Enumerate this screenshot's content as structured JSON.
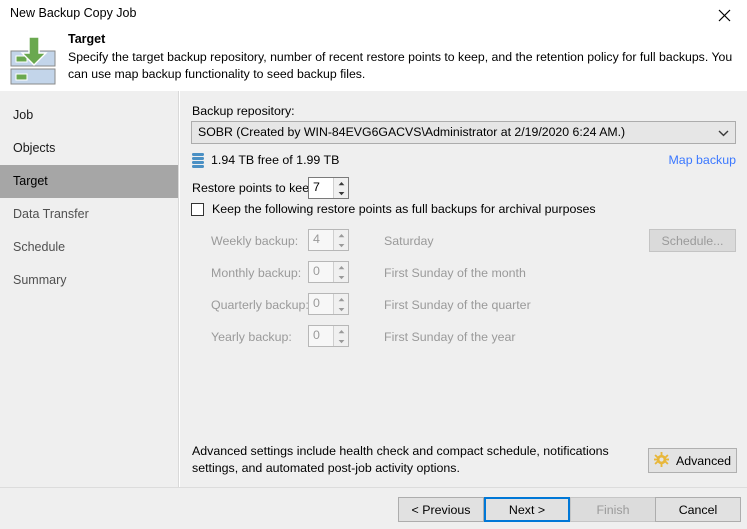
{
  "window": {
    "title": "New Backup Copy Job",
    "close_icon": "close-icon"
  },
  "header": {
    "icon": "backup-repository-download-icon",
    "title": "Target",
    "description": "Specify the target backup repository, number of recent restore points to keep, and the retention policy for full backups. You can use map backup functionality to seed backup files."
  },
  "sidebar": {
    "items": [
      {
        "label": "Job",
        "state": "done"
      },
      {
        "label": "Objects",
        "state": "done"
      },
      {
        "label": "Target",
        "state": "active"
      },
      {
        "label": "Data Transfer",
        "state": "upcoming"
      },
      {
        "label": "Schedule",
        "state": "upcoming"
      },
      {
        "label": "Summary",
        "state": "upcoming"
      }
    ]
  },
  "main": {
    "repository": {
      "label": "Backup repository:",
      "selected": "SOBR (Created by WIN-84EVG6GACVS\\Administrator at 2/19/2020 6:24 AM.)",
      "chevron_icon": "chevron-down-icon",
      "disk_icon": "repository-disk-icon",
      "free_space": "1.94 TB free of 1.99 TB",
      "map_backup_link": "Map backup"
    },
    "restore_points": {
      "label": "Restore points to keep:",
      "value": "7"
    },
    "keep_full": {
      "label": "Keep the following restore points as full backups for archival purposes",
      "checked": false
    },
    "periodic": [
      {
        "name": "Weekly backup:",
        "value": "4",
        "when": "Saturday"
      },
      {
        "name": "Monthly backup:",
        "value": "0",
        "when": "First Sunday of the month"
      },
      {
        "name": "Quarterly backup:",
        "value": "0",
        "when": "First Sunday of the quarter"
      },
      {
        "name": "Yearly backup:",
        "value": "0",
        "when": "First Sunday of the year"
      }
    ],
    "schedule_button": "Schedule...",
    "advanced": {
      "text": "Advanced settings include health check and compact schedule, notifications settings, and automated post-job activity options.",
      "button_label": "Advanced",
      "button_icon": "gear-icon"
    }
  },
  "footer": {
    "previous": "< Previous",
    "next": "Next >",
    "finish": "Finish",
    "cancel": "Cancel"
  },
  "colors": {
    "accent": "#0078d7",
    "link": "#3b78ff",
    "gear": "#e8b73a",
    "arrow_green": "#6aa84f",
    "repo_blue": "#4a90c4",
    "sidebar_active": "#a6a6a6",
    "body_bg": "#efefef"
  }
}
